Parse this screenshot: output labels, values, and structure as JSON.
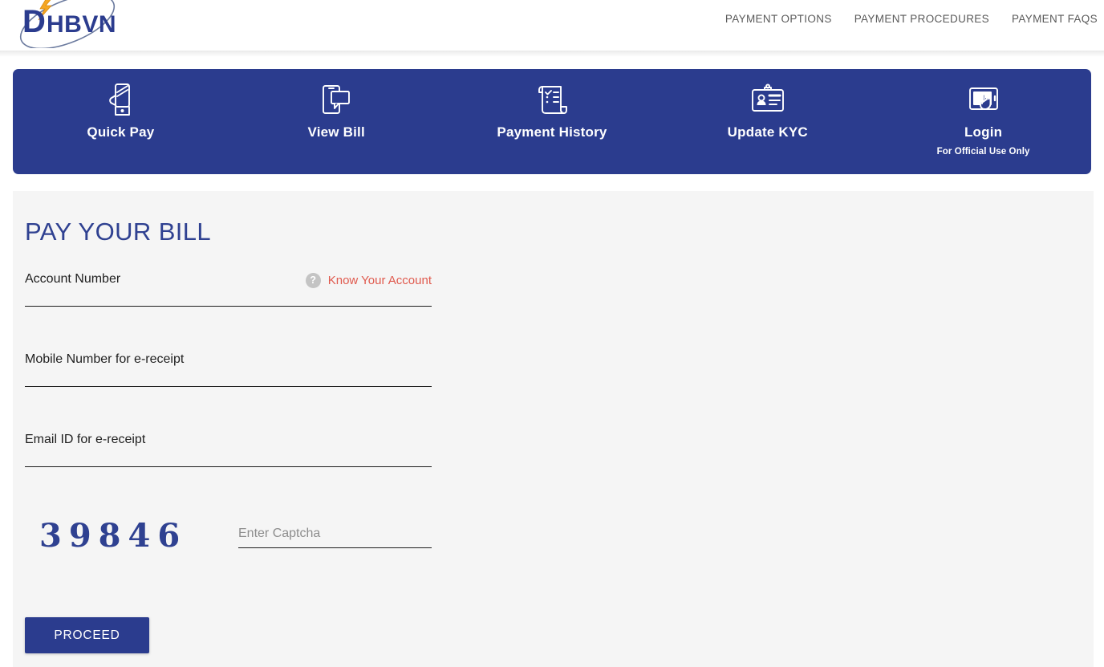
{
  "header": {
    "logo_text": "DHBVN",
    "logo_icon": "dhbvn-logo-lightning-orbit",
    "nav_links": [
      {
        "label": "PAYMENT OPTIONS",
        "name": "payment-options"
      },
      {
        "label": "PAYMENT PROCEDURES",
        "name": "payment-procedures"
      },
      {
        "label": "PAYMENT FAQS",
        "name": "payment-faqs"
      }
    ]
  },
  "main_nav": {
    "background_color": "#2b3c8e",
    "items": [
      {
        "label": "Quick Pay",
        "sublabel": "",
        "icon": "hand-holding-phone-icon"
      },
      {
        "label": "View Bill",
        "sublabel": "",
        "icon": "phone-speech-bubble-icon"
      },
      {
        "label": "Payment History",
        "sublabel": "",
        "icon": "receipt-scroll-checklist-icon"
      },
      {
        "label": "Update KYC",
        "sublabel": "",
        "icon": "id-card-badge-icon"
      },
      {
        "label": "Login",
        "sublabel": "For Official Use Only",
        "icon": "tablet-tap-hand-icon"
      }
    ]
  },
  "content": {
    "title": "PAY YOUR BILL",
    "accent_color": "#2f4191",
    "link_color": "#e05a4e",
    "fields": [
      {
        "label": "Account Number",
        "value": "",
        "placeholder": "",
        "name": "account-number"
      },
      {
        "label": "Mobile Number for e-receipt",
        "value": "",
        "placeholder": "",
        "name": "mobile-number"
      },
      {
        "label": "Email ID for e-receipt",
        "value": "",
        "placeholder": "",
        "name": "email-id"
      }
    ],
    "help": {
      "icon_glyph": "?",
      "link_label": "Know Your Account"
    },
    "captcha": {
      "code": "39846",
      "input_value": "",
      "input_placeholder": "Enter Captcha"
    },
    "submit_label": "PROCEED"
  }
}
